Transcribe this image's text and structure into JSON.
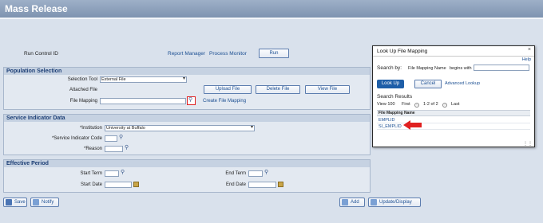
{
  "page": {
    "title": "Mass Release",
    "run_control_label": "Run Control ID",
    "report_manager": "Report Manager",
    "process_monitor": "Process Monitor",
    "run_button": "Run"
  },
  "population": {
    "title": "Population Selection",
    "selection_tool_label": "Selection Tool",
    "selection_tool_value": "External File",
    "attached_file_label": "Attached File",
    "file_mapping_label": "File Mapping",
    "upload_file": "Upload File",
    "delete_file": "Delete File",
    "view_file": "View File",
    "create_file_mapping": "Create File Mapping"
  },
  "service_indicator": {
    "title": "Service Indicator Data",
    "institution_label": "*Institution",
    "institution_value": "University at Buffalo",
    "code_label": "*Service Indicator Code",
    "reason_label": "*Reason"
  },
  "effective": {
    "title": "Effective Period",
    "start_term": "Start Term",
    "end_term": "End Term",
    "start_date": "Start Date",
    "end_date": "End Date"
  },
  "footer": {
    "save": "Save",
    "notify": "Notify",
    "add": "Add",
    "update_display": "Update/Display"
  },
  "lookup": {
    "title": "Look Up File Mapping",
    "help": "Help",
    "search_by_label": "Search by:",
    "search_by_field": "File Mapping Name",
    "search_operator": "begins with",
    "look_up_button": "Look Up",
    "cancel_button": "Cancel",
    "advanced_lookup": "Advanced Lookup",
    "results_title": "Search Results",
    "view_100": "View 100",
    "first": "First",
    "range": "1-2 of 2",
    "last": "Last",
    "column_header": "File Mapping Name",
    "rows": [
      "EMPLID",
      "SI_EMPLID"
    ]
  },
  "colors": {
    "accent": "#1e5ea8",
    "arrow": "#e02020",
    "background": "#d9e1ec"
  }
}
